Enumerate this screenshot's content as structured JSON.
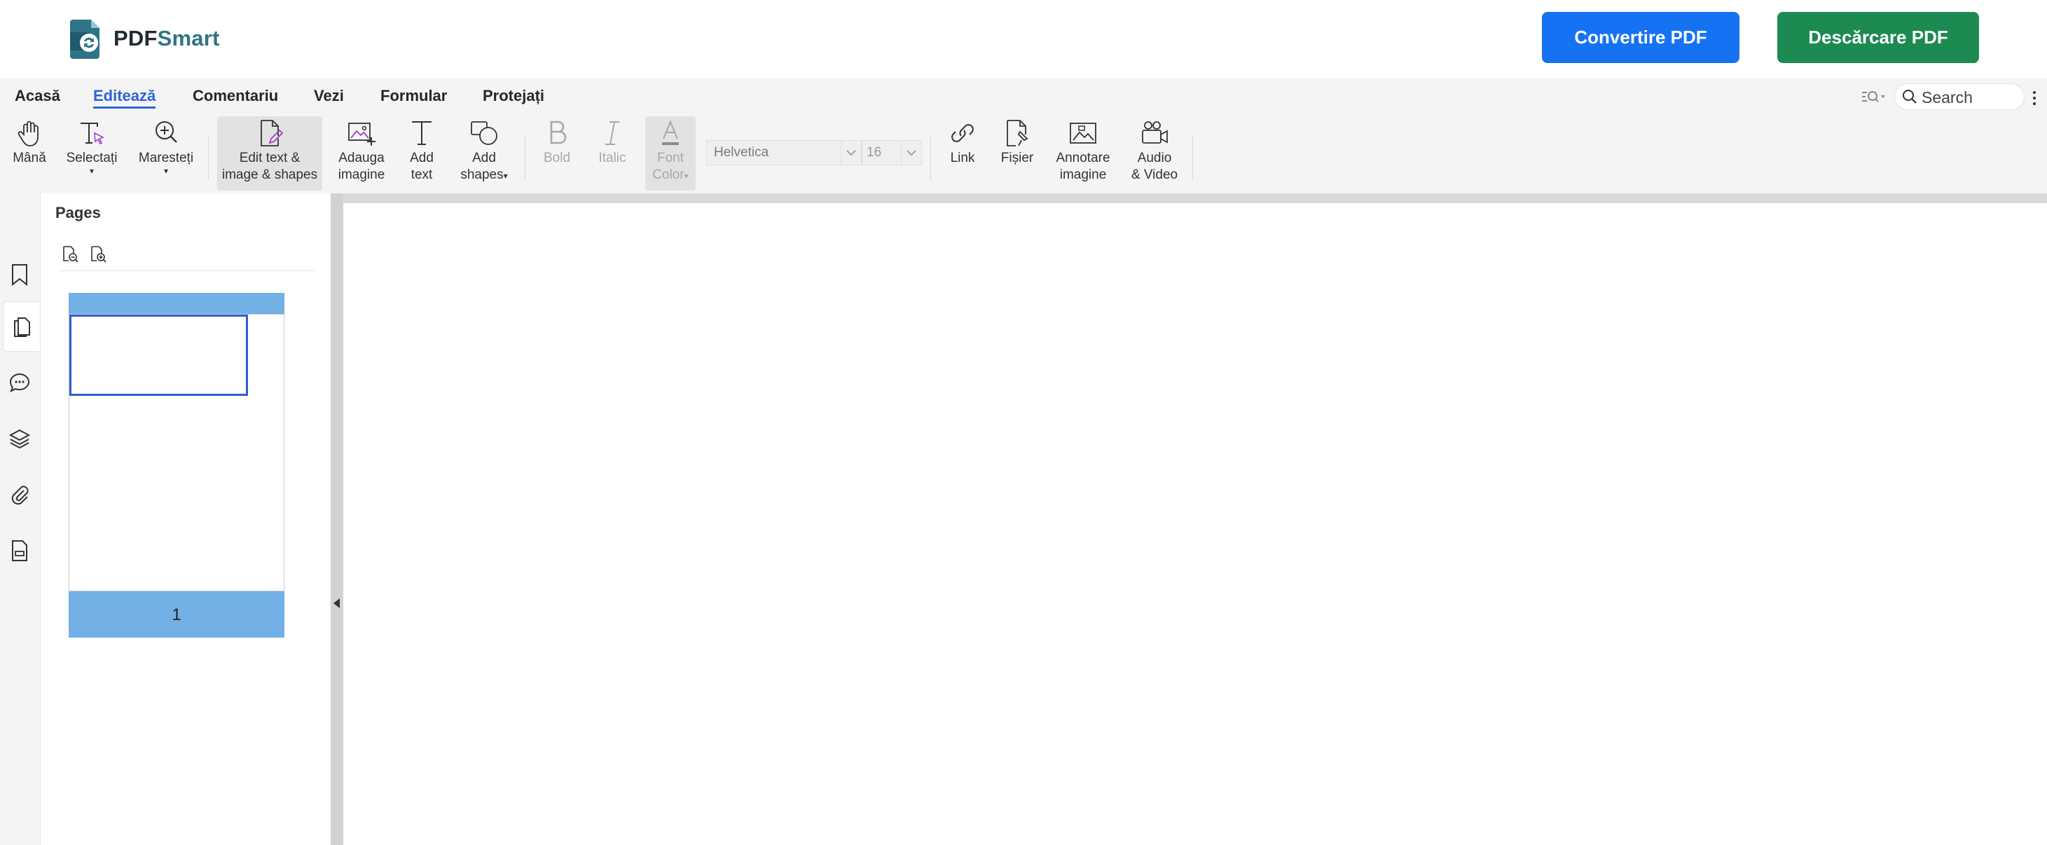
{
  "brand": {
    "name_part1": "PDF",
    "name_part2": "Smart",
    "accent_teal": "#2f7486",
    "dark": "#1f2a33"
  },
  "header": {
    "convert_label": "Convertire PDF",
    "download_label": "Descărcare PDF",
    "convert_color": "#1573f3",
    "download_color": "#1d8a52"
  },
  "menu": {
    "tabs": [
      {
        "label": "Acasă",
        "active": false
      },
      {
        "label": "Editează",
        "active": true
      },
      {
        "label": "Comentariu",
        "active": false
      },
      {
        "label": "Vezi",
        "active": false
      },
      {
        "label": "Formular",
        "active": false
      },
      {
        "label": "Protejați",
        "active": false
      }
    ],
    "active_color": "#2f62d6"
  },
  "search": {
    "placeholder": "Search"
  },
  "toolbar": {
    "hand": {
      "label": "Mână",
      "icon": "hand-icon"
    },
    "select": {
      "label": "Selectați",
      "icon": "text-select-icon"
    },
    "zoom": {
      "label": "Maresteți",
      "icon": "zoom-in-icon"
    },
    "edit": {
      "line1": "Edit text &",
      "line2": "image & shapes",
      "icon": "edit-document-icon"
    },
    "add_image": {
      "line1": "Adauga",
      "line2": "imagine",
      "icon": "add-image-icon"
    },
    "add_text": {
      "line1": "Add",
      "line2": "text",
      "icon": "add-text-icon"
    },
    "add_shapes": {
      "line1": "Add",
      "line2": "shapes",
      "icon": "shapes-icon"
    },
    "bold": {
      "label": "Bold",
      "icon": "bold-icon"
    },
    "italic": {
      "label": "Italic",
      "icon": "italic-icon"
    },
    "font_color": {
      "line1": "Font",
      "line2": "Color",
      "icon": "font-color-icon"
    },
    "font_family": "Helvetica",
    "font_size": "16",
    "link": {
      "label": "Link",
      "icon": "link-icon"
    },
    "file": {
      "label": "Fișier",
      "icon": "file-attach-icon"
    },
    "annot_image": {
      "line1": "Annotare",
      "line2": "imagine",
      "icon": "image-annotation-icon"
    },
    "audio_video": {
      "line1": "Audio",
      "line2": "& Video",
      "icon": "video-camera-icon"
    }
  },
  "sidebar": {
    "icons": [
      "bookmark-icon",
      "pages-icon",
      "comments-icon",
      "layers-icon",
      "attachment-icon",
      "form-icon"
    ],
    "active": "pages-icon"
  },
  "pages_panel": {
    "title": "Pages",
    "thumbnails": [
      {
        "page_number": "1"
      }
    ],
    "thumb_accent": "#72b0e6"
  }
}
